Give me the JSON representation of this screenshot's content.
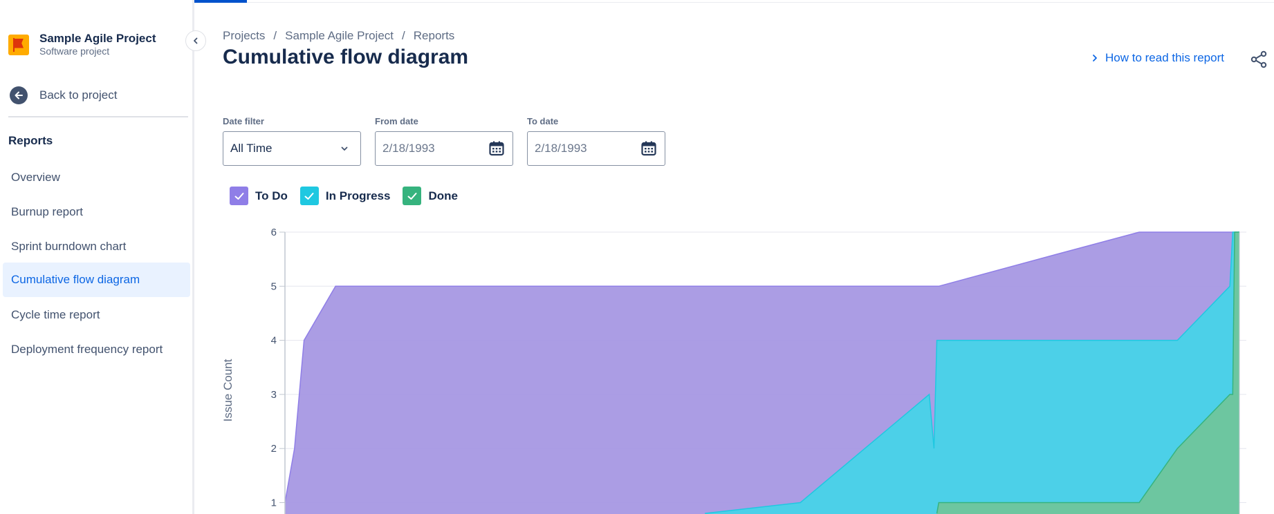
{
  "sidebar": {
    "project_name": "Sample Agile Project",
    "project_type": "Software project",
    "back_label": "Back to project",
    "section_title": "Reports",
    "items": [
      {
        "label": "Overview",
        "active": false
      },
      {
        "label": "Burnup report",
        "active": false
      },
      {
        "label": "Sprint burndown chart",
        "active": false
      },
      {
        "label": "Cumulative flow diagram",
        "active": true
      },
      {
        "label": "Cycle time report",
        "active": false
      },
      {
        "label": "Deployment frequency report",
        "active": false
      }
    ]
  },
  "header": {
    "breadcrumbs": [
      "Projects",
      "Sample Agile Project",
      "Reports"
    ],
    "title": "Cumulative flow diagram",
    "help_link": "How to read this report"
  },
  "filters": {
    "date_filter_label": "Date filter",
    "date_filter_value": "All Time",
    "from_label": "From date",
    "from_value": "2/18/1993",
    "to_label": "To date",
    "to_value": "2/18/1993"
  },
  "legend": [
    {
      "label": "To Do",
      "color": "#8f7ee7",
      "checked": true
    },
    {
      "label": "In Progress",
      "color": "#1fc8e1",
      "checked": true
    },
    {
      "label": "Done",
      "color": "#36b37e",
      "checked": true
    }
  ],
  "colors": {
    "accent": "#0c66e4",
    "todo_fill": "#a698e3",
    "inprogress_fill": "#47d3e8",
    "done_fill": "#6fc59c"
  },
  "chart_data": {
    "type": "area",
    "ylabel": "Issue Count",
    "y_ticks": [
      1,
      2,
      3,
      4,
      5,
      6
    ],
    "ylim": [
      0.8,
      6
    ],
    "x": [
      0,
      0.01,
      0.02,
      0.053,
      0.44,
      0.54,
      0.675,
      0.68,
      0.683,
      0.685,
      0.8,
      0.895,
      0.935,
      0.99,
      0.993,
      0.995,
      1.0
    ],
    "series": [
      {
        "name": "To Do",
        "values": [
          1,
          2,
          4,
          5,
          5,
          5,
          5,
          5,
          5,
          5,
          5.55,
          6,
          6,
          6,
          6,
          6,
          6
        ]
      },
      {
        "name": "In Progress",
        "values": [
          null,
          null,
          null,
          null,
          0.8,
          1,
          3,
          2,
          4,
          4,
          4,
          4,
          4,
          5,
          6,
          6,
          6
        ]
      },
      {
        "name": "Done",
        "values": [
          null,
          null,
          null,
          null,
          null,
          null,
          null,
          null,
          0.8,
          1,
          1,
          1,
          2,
          3,
          3,
          6,
          6
        ]
      }
    ]
  }
}
